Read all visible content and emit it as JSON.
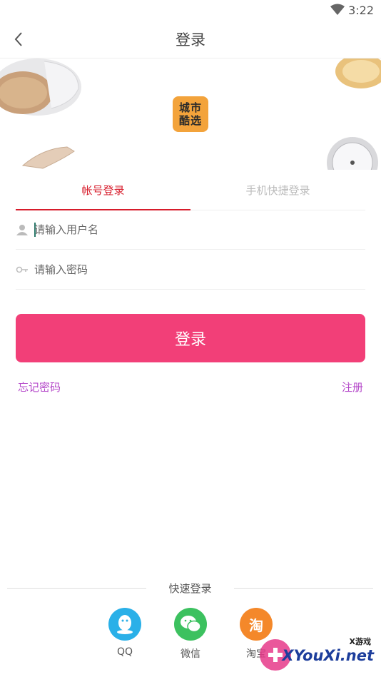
{
  "status_bar": {
    "time": "3:22"
  },
  "nav": {
    "title": "登录"
  },
  "banner": {
    "logo_line1": "城市",
    "logo_line2": "酷选"
  },
  "tabs": {
    "account_login": "帐号登录",
    "phone_login": "手机快捷登录"
  },
  "form": {
    "username_placeholder": "请输入用户名",
    "password_placeholder": "请输入密码",
    "username_value": "",
    "password_value": ""
  },
  "actions": {
    "login_label": "登录",
    "forgot_password": "忘记密码",
    "register": "注册"
  },
  "quick_login": {
    "label": "快速登录",
    "providers": [
      {
        "label": "QQ",
        "icon": "qq-icon",
        "color": "#2ab0e8"
      },
      {
        "label": "微信",
        "icon": "wechat-icon",
        "color": "#3cc15f"
      },
      {
        "label": "淘宝",
        "icon": "taobao-icon",
        "color": "#f4882a",
        "glyph": "淘"
      }
    ]
  },
  "watermark": {
    "small": "X游戏",
    "big": "XYouXi.net"
  },
  "colors": {
    "accent": "#f23f78",
    "tab_active": "#d71c2b",
    "link": "#b447c9",
    "logo_bg": "#f3a33b"
  }
}
